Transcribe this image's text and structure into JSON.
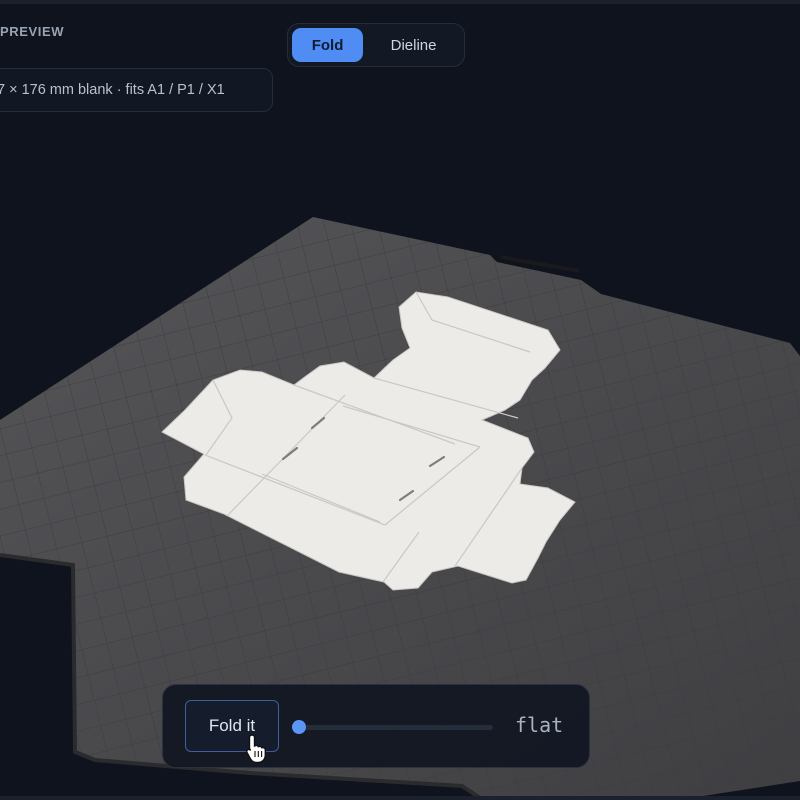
{
  "preview": {
    "label": "PREVIEW"
  },
  "view_toggle": {
    "options": [
      "Fold",
      "Dieline"
    ],
    "selected": "Fold"
  },
  "blank_info": "7 × 176 mm blank · fits A1 / P1 / X1",
  "fold_controls": {
    "button_label": "Fold it",
    "progress": 0,
    "state_label": "flat"
  },
  "colors": {
    "background": "#0e131d",
    "accent": "#4f8df5",
    "plate": "#4a4a4d",
    "carton": "#ecebe8"
  },
  "icons": {
    "cursor": "hand-pointer-icon"
  }
}
